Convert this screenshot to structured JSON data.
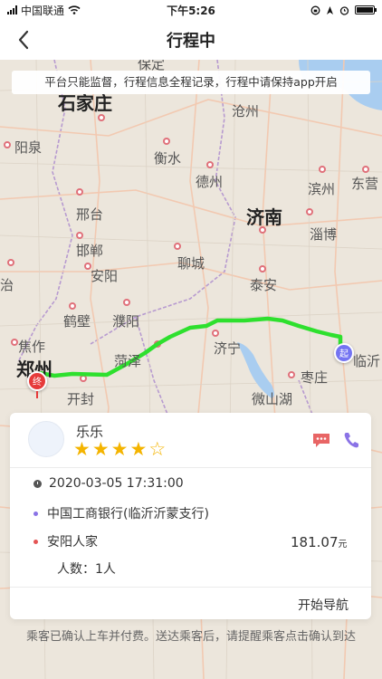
{
  "status_bar": {
    "carrier": "中国联通",
    "time": "下午5:26"
  },
  "nav": {
    "title": "行程中"
  },
  "notice": "平台只能监督，行程信息全程记录，行程中请保持app开启",
  "map": {
    "cities": [
      {
        "name": "保定",
        "big": false
      },
      {
        "name": "石家庄",
        "big": true
      },
      {
        "name": "沧州",
        "big": false
      },
      {
        "name": "阳泉",
        "big": false
      },
      {
        "name": "衡水",
        "big": false
      },
      {
        "name": "德州",
        "big": false
      },
      {
        "name": "滨州",
        "big": false
      },
      {
        "name": "东营",
        "big": false
      },
      {
        "name": "邢台",
        "big": false
      },
      {
        "name": "济南",
        "big": true
      },
      {
        "name": "淄博",
        "big": false
      },
      {
        "name": "邯郸",
        "big": false
      },
      {
        "name": "聊城",
        "big": false
      },
      {
        "name": "安阳",
        "big": false
      },
      {
        "name": "泰安",
        "big": false
      },
      {
        "name": "治",
        "big": false
      },
      {
        "name": "鹤壁",
        "big": false
      },
      {
        "name": "濮阳",
        "big": false
      },
      {
        "name": "焦作",
        "big": false
      },
      {
        "name": "郑州",
        "big": true
      },
      {
        "name": "菏泽",
        "big": false
      },
      {
        "name": "济宁",
        "big": false
      },
      {
        "name": "临沂",
        "big": false
      },
      {
        "name": "开封",
        "big": false
      },
      {
        "name": "枣庄",
        "big": false
      },
      {
        "name": "微山湖",
        "big": false
      }
    ],
    "start_marker": "起",
    "end_marker": "终",
    "colors": {
      "route": "#2ee02e",
      "start": "#7474f2",
      "end": "#e63a3a"
    }
  },
  "card": {
    "user_name": "乐乐",
    "rating": 4,
    "rating_max": 5,
    "datetime": "2020-03-05 17:31:00",
    "origin": "中国工商银行(临沂沂蒙支行)",
    "destination": "安阳人家",
    "fare_value": "181.07",
    "fare_unit": "元",
    "passengers": "人数：1人",
    "navigate_label": "开始导航",
    "colors": {
      "origin_dot": "#8a73e6",
      "destination_dot": "#e45454"
    }
  },
  "footer_note": "乘客已确认上车并付费。送达乘客后，请提醒乘客点击确认到达"
}
